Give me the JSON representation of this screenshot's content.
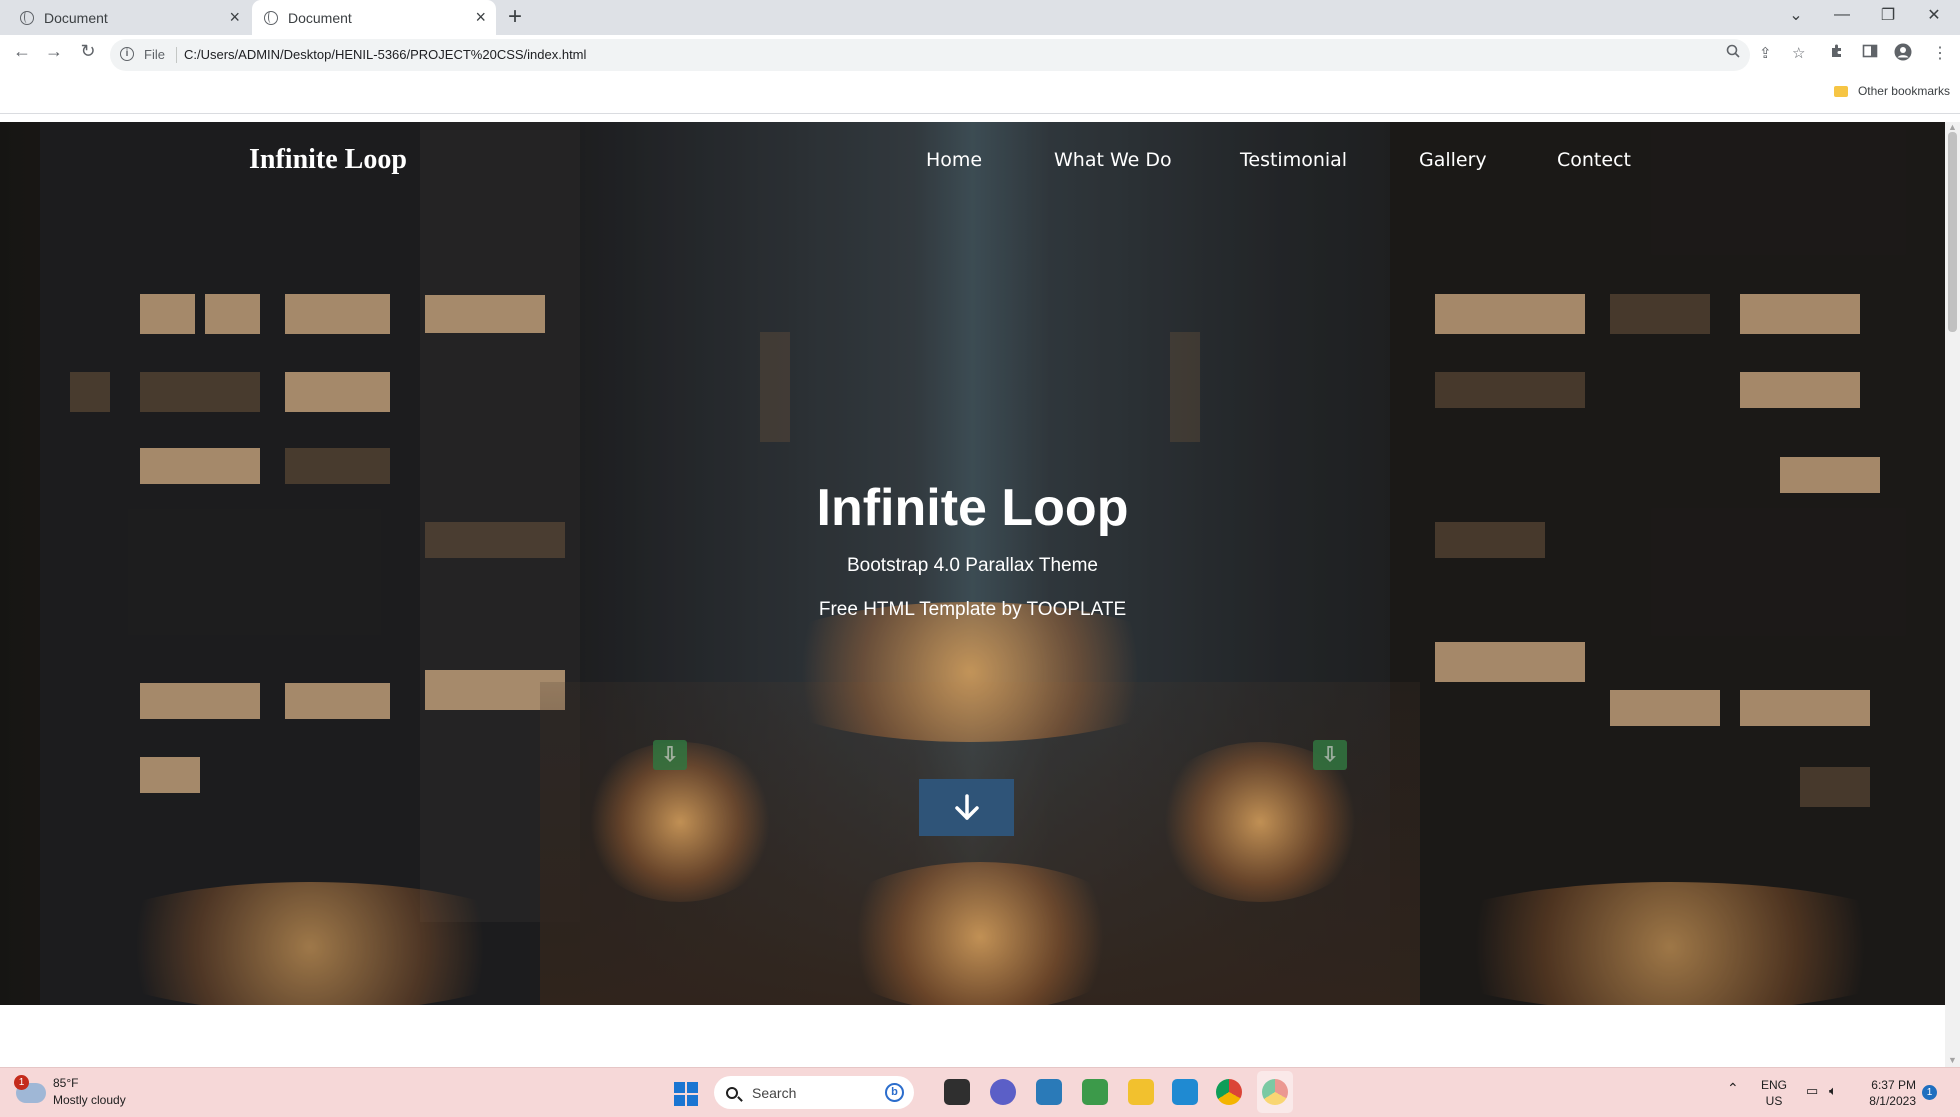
{
  "browser": {
    "tabs": [
      {
        "title": "Document",
        "active": false
      },
      {
        "title": "Document",
        "active": true
      }
    ],
    "scheme_label": "File",
    "url": "C:/Users/ADMIN/Desktop/HENIL-5366/PROJECT%20CSS/index.html",
    "bookmarks_folder": "Other bookmarks"
  },
  "page": {
    "brand": "Infinite Loop",
    "nav": [
      "Home",
      "What We Do",
      "Testimonial",
      "Gallery",
      "Contect"
    ],
    "hero_title": "Infinite Loop",
    "hero_subtitle": "Bootstrap 4.0 Parallax Theme",
    "hero_credit": "Free HTML Template by TOOPLATE",
    "scroll_button_icon": "arrow-down-icon",
    "accent_color": "#2f5478"
  },
  "taskbar": {
    "weather_temp": "85°F",
    "weather_desc": "Mostly cloudy",
    "weather_badge": "1",
    "search_label": "Search",
    "lang_line1": "ENG",
    "lang_line2": "US",
    "time": "6:37 PM",
    "date": "8/1/2023",
    "notification_count": "1"
  }
}
